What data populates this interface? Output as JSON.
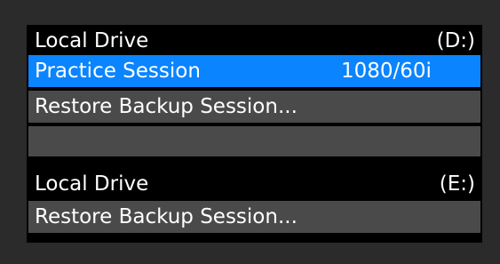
{
  "drives": [
    {
      "name": "Local Drive",
      "letter": "(D:)",
      "items": [
        {
          "label": "Practice Session",
          "format": "1080/60i",
          "selected": true
        },
        {
          "label": "Restore Backup Session...",
          "selected": false
        }
      ]
    },
    {
      "name": "Local Drive",
      "letter": "(E:)",
      "items": [
        {
          "label": "Restore Backup Session...",
          "selected": false
        }
      ]
    }
  ],
  "colors": {
    "background": "#2b2b2b",
    "panel": "#000000",
    "selected": "#0a84ff",
    "item": "#4a4a4a",
    "text": "#ffffff"
  }
}
